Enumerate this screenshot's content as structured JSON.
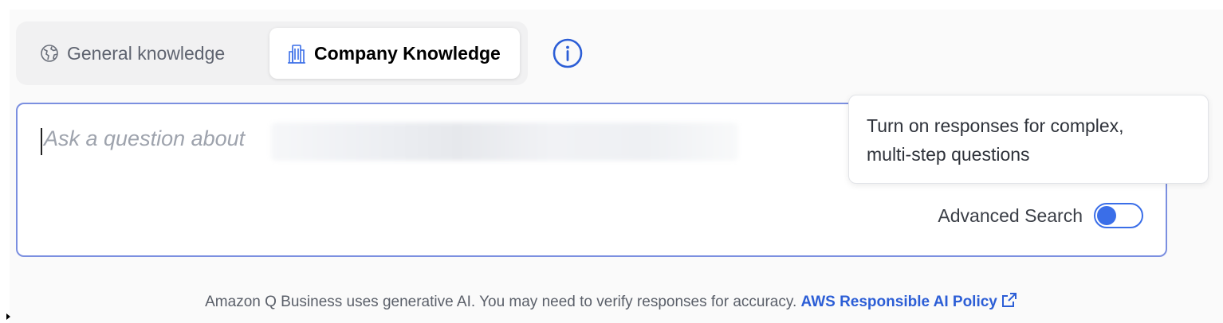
{
  "tabs": {
    "general": {
      "label": "General knowledge",
      "icon": "globe-icon"
    },
    "company": {
      "label": "Company Knowledge",
      "icon": "building-icon",
      "selected": true
    }
  },
  "info": {
    "icon": "info-icon"
  },
  "input": {
    "placeholder": "Ask a question about"
  },
  "advanced_search": {
    "label": "Advanced Search",
    "enabled": false
  },
  "tooltip": {
    "line1": "Turn on responses for complex,",
    "line2": "multi-step questions"
  },
  "footer": {
    "text": "Amazon Q Business uses generative AI. You may need to verify responses for accuracy.",
    "link_label": "AWS Responsible AI Policy",
    "link_icon": "external-link-icon"
  },
  "colors": {
    "accent": "#3a6ee8",
    "link": "#2c5ed6",
    "input_border": "#7b8fe0"
  }
}
